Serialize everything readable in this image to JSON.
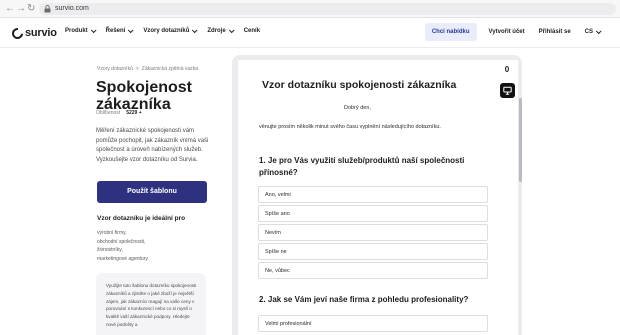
{
  "browser": {
    "url": "survio.com"
  },
  "header": {
    "logo_text": "survio",
    "menu": [
      {
        "label": "Produkt"
      },
      {
        "label": "Řešení"
      },
      {
        "label": "Vzory dotazníků"
      },
      {
        "label": "Zdroje"
      },
      {
        "label": "Ceník"
      }
    ],
    "offer_label": "Chci nabídku",
    "signup_label": "Vytvořit účet",
    "login_label": "Přihlásit se",
    "language": "CS"
  },
  "left": {
    "breadcrumbs": [
      "Vzory dotazníků",
      ">",
      "Zákaznická zpětná vazba"
    ],
    "title": "Spokojenost zákazníka",
    "meta_label": "Oblíbenost",
    "meta_value": "5229 +",
    "description": "Měření zákaznické spokojenosti vám pomůže pochopit, jak zákazník vnímá vaši společnost a úroveň nabízených služeb. Vyzkoušejte vzor dotazníku od Survia.",
    "use_button": "Použít šablonu",
    "ideal_heading": "Vzor dotazníku je ideální pro",
    "ideal_list": [
      "výrobní firmy,",
      "obchodní společnosti,",
      "živnostníky,",
      "marketingové agentury."
    ],
    "info_text": "Využijte tuto šablonu dotazníku spokojenosti zákazníků a zjistěte o jaké zboží je největší zájem, jak zákazníci reagují na vaše ceny v porovnání s konkurencí nebo co si myslí o kvalitě vaší zákaznické podpory. Hledejte nové podněty a"
  },
  "preview": {
    "counter": "0",
    "title": "Vzor dotazníku spokojenosti zákazníka",
    "greeting": "Dobrý den,",
    "intro": "věnujte prosím několik minut svého času vyplnění následujícího dotazníku.",
    "q1": "1. Je pro Vás využití služeb/produktů naší společnosti přínosné?",
    "q1_options": [
      "Ano, velmi",
      "Spíše ano",
      "Nevím",
      "Spíše ne",
      "Ne, vůbec"
    ],
    "q2": "2. Jak se Vám jeví naše firma z pohledu profesionality?",
    "q2_options": [
      "Velmi profesionální"
    ]
  },
  "icons": {
    "lock": "lock-icon",
    "present": "present-icon",
    "back": "arrow-left-icon",
    "forward": "arrow-right-icon",
    "reload": "reload-icon"
  },
  "colors": {
    "primary": "#2d3180",
    "offer_bg": "#e9ecfb",
    "panel_bg": "#ececef"
  }
}
